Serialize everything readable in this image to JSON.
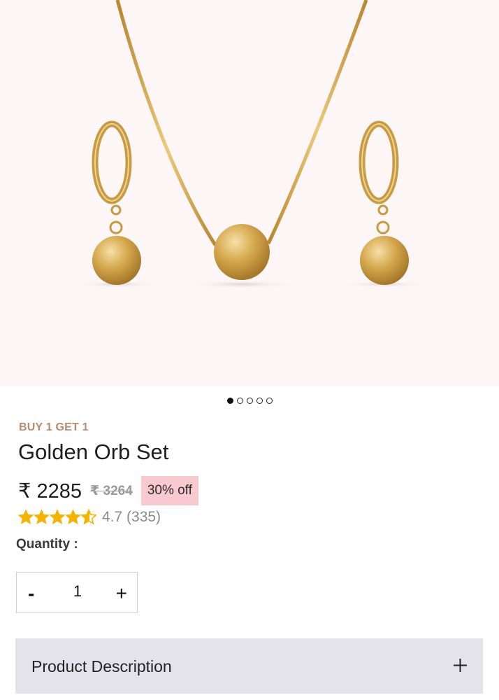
{
  "gallery": {
    "image_alt": "Gold necklace with ball pendant and matching ball hoop earrings",
    "dots": [
      true,
      false,
      false,
      false,
      false
    ]
  },
  "product": {
    "promo": "BUY 1 GET 1",
    "title": "Golden Orb Set",
    "price": "₹ 2285",
    "mrp": "₹ 3264",
    "discount": "30% off",
    "rating": 4.7,
    "rating_text": "4.7 (335)",
    "stars_filled": 4,
    "stars_half": 1
  },
  "quantity": {
    "label": "Quantity :",
    "minus": "-",
    "value": "1",
    "plus": "+"
  },
  "accordion": {
    "label": "Product Description",
    "icon": "plus-icon"
  },
  "colors": {
    "gold": "#c99a3f",
    "promo": "#b88a6e",
    "discount_bg": "#f8c9cf",
    "star": "#f5b301",
    "accordion_bg": "#e4e3ec"
  }
}
